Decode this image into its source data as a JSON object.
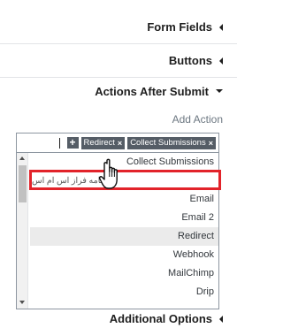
{
  "sections": {
    "form_fields": "Form Fields",
    "buttons": "Buttons",
    "actions_after_submit": "Actions After Submit",
    "additional_options": "Additional Options"
  },
  "add_action": {
    "label": "Add Action",
    "add_button": "+",
    "tokens": [
      {
        "label": "Redirect",
        "remove": "×"
      },
      {
        "label": "Collect Submissions",
        "remove": "×"
      }
    ]
  },
  "dropdown": {
    "options": [
      "Collect Submissions",
      "خبرنامه فراز اس ام اس",
      "Email",
      "Email 2",
      "Redirect",
      "Webhook",
      "MailChimp",
      "Drip"
    ],
    "selected": "Redirect",
    "hovered": "خبرنامه فراز اس ام اس"
  },
  "icons": {
    "collapsed": "caret-left-icon",
    "expanded": "caret-down-icon",
    "cursor": "hand-pointer-icon"
  },
  "colors": {
    "highlight": "#e2232a",
    "token_bg": "#555d66"
  }
}
